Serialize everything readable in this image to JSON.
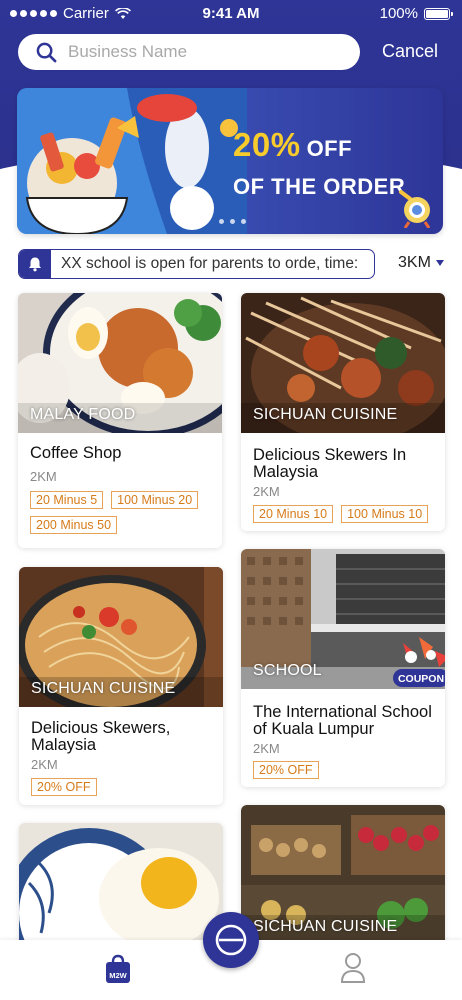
{
  "status_bar": {
    "carrier": "Carrier",
    "time": "9:41 AM",
    "battery": "100%"
  },
  "search": {
    "placeholder": "Business Name",
    "cancel_label": "Cancel"
  },
  "banner": {
    "headline": "20%",
    "headline_suffix": "OFF",
    "subline": "OF THE ORDER",
    "page_count": 3
  },
  "notice": {
    "icon": "bell-icon",
    "text": "XX school is open for parents to orde,  time:"
  },
  "distance_filter": {
    "label": "3KM"
  },
  "cards": [
    {
      "category": "MALAY FOOD",
      "title": "Coffee Shop",
      "distance": "2KM",
      "promos": [
        "20 Minus 5",
        "100 Minus 20",
        "200 Minus 50"
      ]
    },
    {
      "category": "SICHUAN CUISINE",
      "title": "Delicious Skewers In Malaysia",
      "distance": "2KM",
      "promos": [
        "20 Minus 10",
        "100 Minus 10"
      ]
    },
    {
      "category": "SICHUAN CUISINE",
      "title": "Delicious Skewers, Malaysia",
      "distance": "2KM",
      "promos": [
        "20% OFF"
      ]
    },
    {
      "category": "SCHOOL",
      "title": "The International School of Kuala Lumpur",
      "distance": "2KM",
      "promos": [
        "20% OFF"
      ],
      "badge": "COUPON"
    },
    {
      "category": "",
      "title": "",
      "distance": "",
      "promos": []
    },
    {
      "category": "SICHUAN CUISINE",
      "title": "",
      "distance": "",
      "promos": []
    }
  ],
  "bottom_nav": {
    "home_badge": "M2W",
    "home_icon": "shopping-bag-icon",
    "center_icon": "minus-circle-icon",
    "profile_icon": "user-icon"
  },
  "colors": {
    "brand": "#2f3596",
    "promo_border": "#e8a35a",
    "promo_text": "#d67b1a",
    "banner_yellow": "#f7cb2b"
  }
}
